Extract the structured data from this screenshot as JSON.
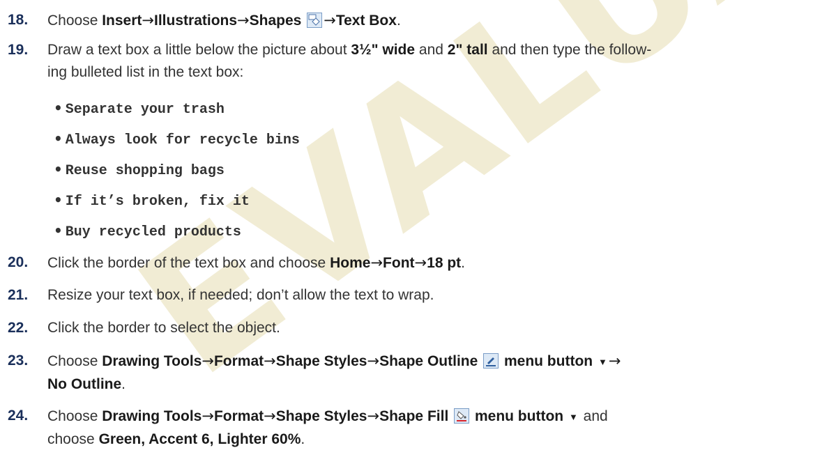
{
  "watermark": "EVALUATION COPY",
  "steps": {
    "s18": {
      "num": "18.",
      "p1": "Choose ",
      "b1": "Insert",
      "b2": "Illustrations",
      "b3": "Shapes",
      "b4": "Text Box",
      "end": ".",
      "icon": "shapes-icon"
    },
    "s19": {
      "num": "19.",
      "p1": "Draw a text box a little below the picture about ",
      "b1": "3½\" wide",
      "p2": " and ",
      "b2": "2\" tall",
      "p3": " and then type the follow-",
      "line2": "ing bulleted list in the text box:"
    },
    "s20": {
      "num": "20.",
      "p1": "Click the border of the text box and choose ",
      "b1": "Home",
      "b2": "Font",
      "b3": "18 pt",
      "end": "."
    },
    "s21": {
      "num": "21.",
      "text": "Resize your text box, if needed; don’t allow the text to wrap."
    },
    "s22": {
      "num": "22.",
      "text": "Click the border to select the object."
    },
    "s23": {
      "num": "23.",
      "p1": "Choose ",
      "b1": "Drawing Tools",
      "b2": "Format",
      "b3": "Shape Styles",
      "b4": "Shape Outline",
      "b5": "menu button",
      "b6": "No Outline",
      "end": ".",
      "icon": "shape-outline-icon"
    },
    "s24": {
      "num": "24.",
      "p1": "Choose ",
      "b1": "Drawing Tools",
      "b2": "Format",
      "b3": "Shape Styles",
      "b4": "Shape Fill",
      "b5": "menu button",
      "p2": " and",
      "line2a": "choose ",
      "b6": "Green, Accent 6, Lighter 60%",
      "end": ".",
      "icon": "shape-fill-icon"
    }
  },
  "bullets": [
    "Separate your trash",
    "Always look for recycle bins",
    "Reuse shopping bags",
    "If it’s broken, fix it",
    "Buy recycled products"
  ],
  "bullet_char": "•",
  "arrow": "→",
  "dropdown_char": "▼",
  "colors": {
    "step_number": "#1a2f5a",
    "text": "#333333",
    "watermark": "#e6ddb0"
  }
}
